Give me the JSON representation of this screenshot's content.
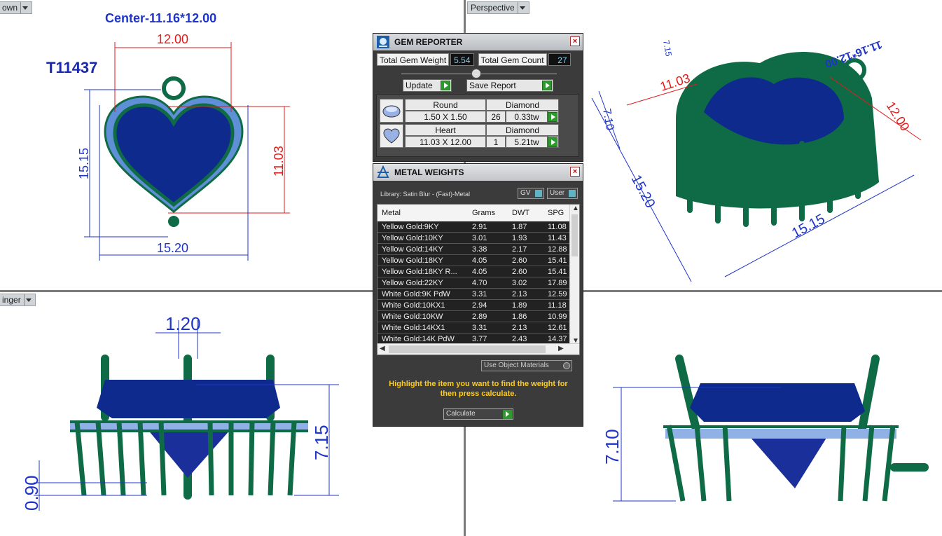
{
  "viewports": {
    "top_left": {
      "tab": "own",
      "center_label": "Center-11.16*12.00",
      "ref": "T11437",
      "dim_top": "12.00",
      "dim_left": "15.15",
      "dim_right": "11.03",
      "dim_bottom": "15.20"
    },
    "top_right": {
      "tab": "Perspective",
      "dim_a": "11.03",
      "dim_b": "7.10",
      "dim_c": "12.00",
      "dim_d": "15.20",
      "dim_e": "15.15",
      "dim_f": "7.15",
      "mirrored_text": "11.16*12.00"
    },
    "bottom_left": {
      "tab": "inger",
      "dim_top": "1.20",
      "dim_right": "7.15",
      "dim_left": "0.90"
    },
    "bottom_right": {
      "dim_left": "7.10"
    }
  },
  "gem_reporter": {
    "title": "GEM REPORTER",
    "total_weight_label": "Total Gem Weight",
    "total_weight_value": "5.54",
    "total_count_label": "Total Gem Count",
    "total_count_value": "27",
    "update_label": "Update",
    "save_label": "Save Report",
    "gems": [
      {
        "shape": "Round",
        "type": "Diamond",
        "size": "1.50 X 1.50",
        "count": "26",
        "weight": "0.33tw"
      },
      {
        "shape": "Heart",
        "type": "Diamond",
        "size": "11.03 X 12.00",
        "count": "1",
        "weight": "5.21tw"
      }
    ]
  },
  "metal_weights": {
    "title": "METAL WEIGHTS",
    "library": "Library: Satin Blur - (Fast)-Metal",
    "gv_label": "GV",
    "user_label": "User",
    "columns": [
      "Metal",
      "Grams",
      "DWT",
      "SPG"
    ],
    "rows": [
      [
        "Yellow Gold:9KY",
        "2.91",
        "1.87",
        "11.08"
      ],
      [
        "Yellow Gold:10KY",
        "3.01",
        "1.93",
        "11.43"
      ],
      [
        "Yellow Gold:14KY",
        "3.38",
        "2.17",
        "12.88"
      ],
      [
        "Yellow Gold:18KY",
        "4.05",
        "2.60",
        "15.41"
      ],
      [
        "Yellow Gold:18KY R...",
        "4.05",
        "2.60",
        "15.41"
      ],
      [
        "Yellow Gold:22KY",
        "4.70",
        "3.02",
        "17.89"
      ],
      [
        "White Gold:9K PdW",
        "3.31",
        "2.13",
        "12.59"
      ],
      [
        "White Gold:10KX1",
        "2.94",
        "1.89",
        "11.18"
      ],
      [
        "White Gold:10KW",
        "2.89",
        "1.86",
        "10.99"
      ],
      [
        "White Gold:14KX1",
        "3.31",
        "2.13",
        "12.61"
      ],
      [
        "White Gold:14K PdW",
        "3.77",
        "2.43",
        "14.37"
      ]
    ],
    "use_object_label": "Use Object Materials",
    "instructions": "Highlight the item you want to find the weight for then press calculate.",
    "calculate_label": "Calculate"
  },
  "colors": {
    "metal": "#0f6b45",
    "stone": "#0d2a8c",
    "accent": "#ffcc1a",
    "dim_blue": "#1f35c8",
    "dim_red": "#e21b1b"
  }
}
